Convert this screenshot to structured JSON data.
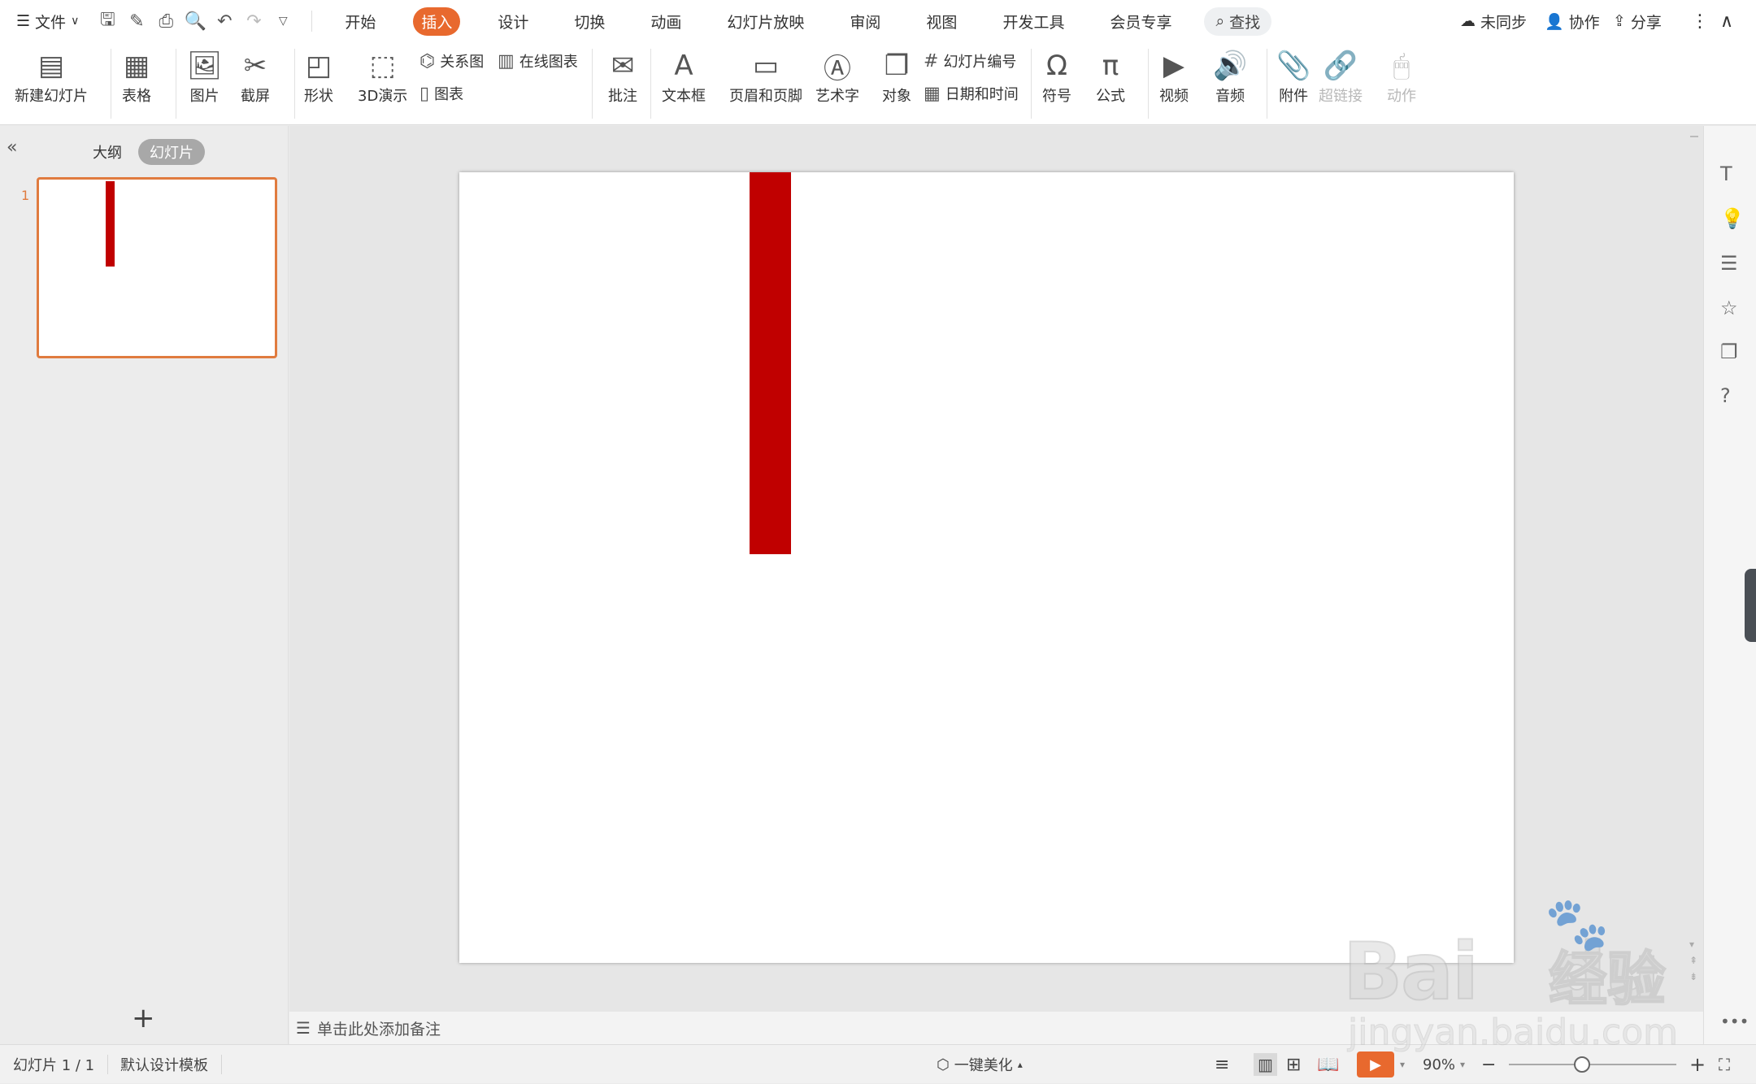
{
  "menubar": {
    "file": "文件",
    "tabs": [
      "开始",
      "插入",
      "设计",
      "切换",
      "动画",
      "幻灯片放映",
      "审阅",
      "视图",
      "开发工具",
      "会员专享"
    ],
    "active_tab": "插入",
    "search": "查找",
    "sync": "未同步",
    "collab": "协作",
    "share": "分享"
  },
  "ribbon": {
    "new_slide": "新建幻灯片",
    "table": "表格",
    "picture": "图片",
    "screenshot": "截屏",
    "shape": "形状",
    "demo3d": "3D演示",
    "relation": "关系图",
    "online_chart": "在线图表",
    "chart": "图表",
    "comment": "批注",
    "textbox": "文本框",
    "header_footer": "页眉和页脚",
    "wordart": "艺术字",
    "object": "对象",
    "slide_number": "幻灯片编号",
    "datetime": "日期和时间",
    "symbol": "符号",
    "formula": "公式",
    "video": "视频",
    "audio": "音频",
    "attachment": "附件",
    "hyperlink": "超链接",
    "action": "动作"
  },
  "left": {
    "outline": "大纲",
    "slides": "幻灯片",
    "slide_index": "1"
  },
  "notes": "单击此处添加备注",
  "status": {
    "slide_count": "幻灯片 1 / 1",
    "template": "默认设计模板",
    "beautify": "一键美化",
    "zoom": "90%"
  },
  "watermark": {
    "line1": "Bai",
    "line2": "du",
    "brand": "经验",
    "url": "jingyan.baidu.com"
  },
  "colors": {
    "accent": "#e8692e",
    "shape": "#c00000"
  }
}
